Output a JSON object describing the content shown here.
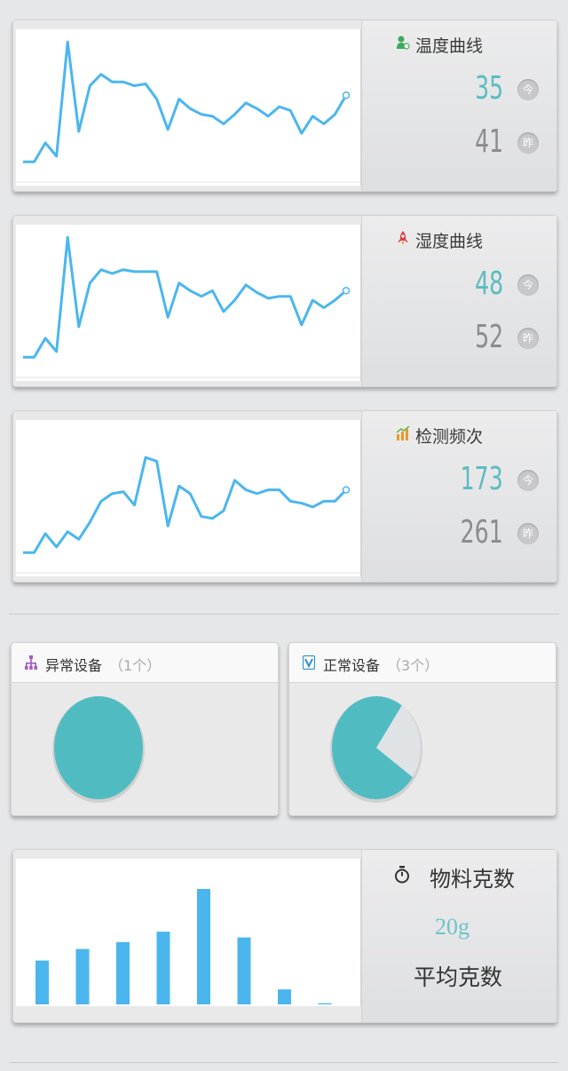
{
  "colors": {
    "line": "#4bb6ee",
    "bar": "#4bb6ee",
    "accent_teal": "#5bbcc0",
    "pie_fill": "#50bcc1",
    "pie_rest": "#dfe3e6"
  },
  "cards": [
    {
      "title": "温度曲线",
      "icon": "user-green-icon",
      "today": "35",
      "yesterday": "41",
      "today_tag": "今",
      "yesterday_tag": "昨",
      "values": [
        5,
        5,
        15,
        8,
        68,
        21,
        45,
        51,
        47,
        47,
        45,
        46,
        38,
        22,
        38,
        33,
        30,
        29,
        25,
        30,
        36,
        33,
        29,
        34,
        32,
        20,
        29,
        25,
        30,
        40
      ]
    },
    {
      "title": "湿度曲线",
      "icon": "rocket-red-icon",
      "today": "48",
      "yesterday": "52",
      "today_tag": "今",
      "yesterday_tag": "昨",
      "values": [
        5,
        5,
        15,
        8,
        68,
        21,
        44,
        51,
        49,
        51,
        50,
        50,
        50,
        26,
        44,
        40,
        37,
        40,
        29,
        35,
        43,
        39,
        36,
        37,
        37,
        22,
        35,
        31,
        35,
        40
      ]
    },
    {
      "title": "检测频次",
      "icon": "chart-orange-icon",
      "today": "173",
      "yesterday": "261",
      "today_tag": "今",
      "yesterday_tag": "昨",
      "values": [
        5,
        5,
        15,
        8,
        16,
        12,
        21,
        32,
        36,
        37,
        30,
        55,
        53,
        19,
        40,
        36,
        24,
        23,
        27,
        43,
        38,
        36,
        38,
        38,
        32,
        31,
        29,
        32,
        32,
        38
      ]
    }
  ],
  "devices": {
    "abnormal": {
      "label": "异常设备",
      "count": "（1个）",
      "icon": "network-icon",
      "fraction": 1.0
    },
    "normal": {
      "label": "正常设备",
      "count": "（3个）",
      "icon": "v-badge-icon",
      "fraction": 0.75
    }
  },
  "material": {
    "title": "物料克数",
    "value": "20g",
    "subtitle": "平均克数",
    "icon": "timer-icon",
    "bar_values": [
      38,
      48,
      54,
      63,
      100,
      58,
      13,
      1
    ]
  },
  "chart_data": [
    {
      "type": "line",
      "values": [
        5,
        5,
        15,
        8,
        68,
        21,
        45,
        51,
        47,
        47,
        45,
        46,
        38,
        22,
        38,
        33,
        30,
        29,
        25,
        30,
        36,
        33,
        29,
        34,
        32,
        20,
        29,
        25,
        30,
        40
      ]
    },
    {
      "type": "line",
      "values": [
        5,
        5,
        15,
        8,
        68,
        21,
        44,
        51,
        49,
        51,
        50,
        50,
        50,
        26,
        44,
        40,
        37,
        40,
        29,
        35,
        43,
        39,
        36,
        37,
        37,
        22,
        35,
        31,
        35,
        40
      ]
    },
    {
      "type": "line",
      "values": [
        5,
        5,
        15,
        8,
        16,
        12,
        21,
        32,
        36,
        37,
        30,
        55,
        53,
        19,
        40,
        36,
        24,
        23,
        27,
        43,
        38,
        36,
        38,
        38,
        32,
        31,
        29,
        32,
        32,
        38
      ]
    },
    {
      "type": "pie",
      "values": [
        1
      ]
    },
    {
      "type": "pie",
      "values": [
        0.75,
        0.25
      ]
    },
    {
      "type": "bar",
      "values": [
        38,
        48,
        54,
        63,
        100,
        58,
        13,
        1
      ]
    }
  ]
}
